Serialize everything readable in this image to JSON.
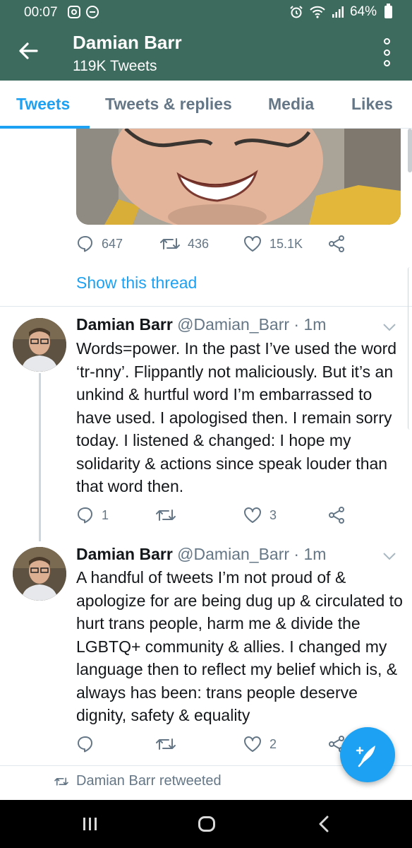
{
  "status_bar": {
    "time": "00:07",
    "battery": "64%"
  },
  "app_bar": {
    "title": "Damian Barr",
    "subtitle": "119K Tweets"
  },
  "tabs": [
    {
      "label": "Tweets",
      "active": true
    },
    {
      "label": "Tweets & replies",
      "active": false
    },
    {
      "label": "Media",
      "active": false
    },
    {
      "label": "Likes",
      "active": false
    }
  ],
  "tweet_top": {
    "replies": "647",
    "retweets": "436",
    "likes": "15.1K",
    "show_thread": "Show this thread"
  },
  "tweets": [
    {
      "name": "Damian Barr",
      "handle": "@Damian_Barr · 1m",
      "text": "Words=power. In the past I’ve used the word ‘tr-nny’. Flippantly not maliciously. But it’s an unkind & hurtful word I’m embarrassed to have used. I apologised then. I remain sorry today. I listened & changed: I hope my solidarity & actions since speak louder than that word then.",
      "replies": "1",
      "retweets": "",
      "likes": "3"
    },
    {
      "name": "Damian Barr",
      "handle": "@Damian_Barr · 1m",
      "text": "A handful of tweets I’m not proud of & apologize for are being dug up & circulated to hurt trans people, harm me & divide the LGBTQ+ community & allies. I changed my language then to reflect my belief which is, & always has been: trans people deserve dignity, safety & equality",
      "replies": "",
      "retweets": "",
      "likes": "2"
    }
  ],
  "retweet_label": "Damian Barr retweeted",
  "colors": {
    "app_bar": "#3d6b5e",
    "accent": "#1da1f2",
    "secondary_text": "#657786"
  }
}
